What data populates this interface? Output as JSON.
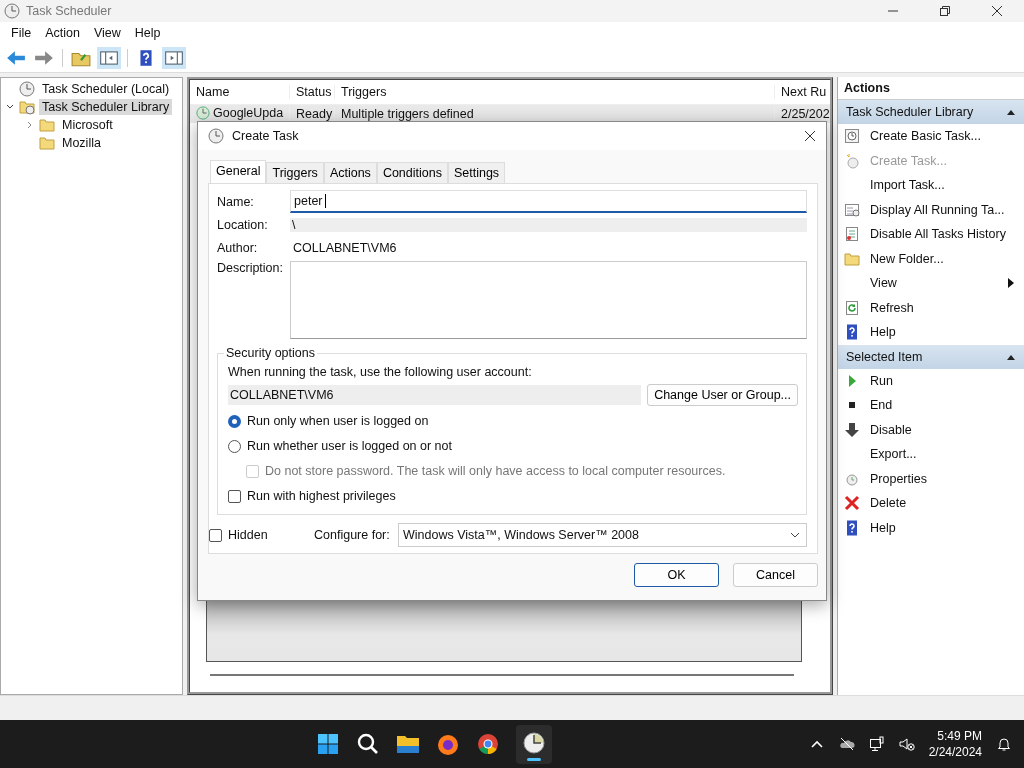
{
  "window": {
    "title": "Task Scheduler"
  },
  "menu": [
    "File",
    "Action",
    "View",
    "Help"
  ],
  "tree": {
    "root": "Task Scheduler (Local)",
    "items": [
      {
        "label": "Task Scheduler Library",
        "selected": true,
        "expanded": true,
        "children": [
          {
            "label": "Microsoft",
            "selected": false,
            "expanded": false
          },
          {
            "label": "Mozilla",
            "selected": false
          }
        ]
      }
    ]
  },
  "task_list": {
    "columns": [
      "Name",
      "Status",
      "Triggers",
      "Next Ru"
    ],
    "rows": [
      {
        "cells": [
          "GoogleUpda",
          "Ready",
          "Multiple triggers defined",
          "2/25/202"
        ]
      }
    ]
  },
  "dialog": {
    "title": "Create Task",
    "tabs": [
      {
        "label": "General",
        "selected": true
      },
      {
        "label": "Triggers",
        "selected": false
      },
      {
        "label": "Actions",
        "selected": false
      },
      {
        "label": "Conditions",
        "selected": false
      },
      {
        "label": "Settings",
        "selected": false
      }
    ],
    "name_label": "Name:",
    "name_value": "peter",
    "location_label": "Location:",
    "location_value": "\\",
    "author_label": "Author:",
    "author_value": "COLLABNET\\VM6",
    "description_label": "Description:",
    "security": {
      "title": "Security options",
      "prompt": "When running the task, use the following user account:",
      "account": "COLLABNET\\VM6",
      "change_button": "Change User or Group...",
      "logon_options": [
        {
          "label": "Run only when user is logged on",
          "selected": true
        },
        {
          "label": "Run whether user is logged on or not",
          "selected": false
        }
      ],
      "no_password": {
        "label": "Do not store password.  The task will only have access to local computer resources.",
        "checked": false,
        "disabled": true
      },
      "highest": {
        "label": "Run with highest privileges",
        "checked": false,
        "disabled": false
      }
    },
    "hidden": {
      "label": "Hidden",
      "checked": false
    },
    "configure_label": "Configure for:",
    "configure_value": "Windows Vista™, Windows Server™ 2008",
    "buttons": [
      {
        "label": "OK",
        "default": true
      },
      {
        "label": "Cancel",
        "default": false
      }
    ]
  },
  "actions": {
    "title": "Actions",
    "sections": [
      {
        "title": "Task Scheduler Library",
        "expanded": true,
        "items": [
          {
            "label": "Create Basic Task...",
            "kind": "basic-task",
            "disabled": false
          },
          {
            "label": "Create Task...",
            "kind": "new-task",
            "disabled": true
          },
          {
            "label": "Import Task...",
            "kind": "plain",
            "disabled": false
          },
          {
            "label": "Display All Running Ta...",
            "kind": "running",
            "disabled": false
          },
          {
            "label": "Disable All Tasks History",
            "kind": "history",
            "disabled": false
          },
          {
            "label": "New Folder...",
            "kind": "folder",
            "disabled": false
          },
          {
            "label": "View",
            "kind": "submenu",
            "disabled": false
          },
          {
            "label": "Refresh",
            "kind": "refresh",
            "disabled": false
          },
          {
            "label": "Help",
            "kind": "help",
            "disabled": false
          }
        ]
      },
      {
        "title": "Selected Item",
        "expanded": true,
        "items": [
          {
            "label": "Run",
            "kind": "run",
            "disabled": false
          },
          {
            "label": "End",
            "kind": "end",
            "disabled": false
          },
          {
            "label": "Disable",
            "kind": "disable",
            "disabled": false
          },
          {
            "label": "Export...",
            "kind": "plain",
            "disabled": false
          },
          {
            "label": "Properties",
            "kind": "properties",
            "disabled": false
          },
          {
            "label": "Delete",
            "kind": "delete",
            "disabled": false
          },
          {
            "label": "Help",
            "kind": "help",
            "disabled": false
          }
        ]
      }
    ]
  },
  "taskbar": {
    "time": "5:49 PM",
    "date": "2/24/2024"
  }
}
